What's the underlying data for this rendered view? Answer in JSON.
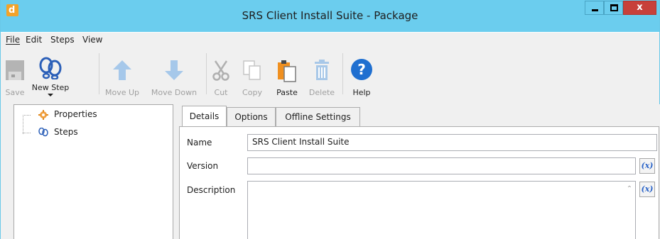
{
  "window": {
    "title": "SRS Client Install Suite - Package",
    "app_icon_letter": "d",
    "minimize_glyph": "_",
    "close_glyph": "x"
  },
  "menu": {
    "file": "File",
    "edit": "Edit",
    "steps": "Steps",
    "view": "View"
  },
  "toolbar": {
    "save": "Save",
    "new_step": "New Step",
    "move_up": "Move Up",
    "move_down": "Move Down",
    "cut": "Cut",
    "copy": "Copy",
    "paste": "Paste",
    "delete": "Delete",
    "help": "Help"
  },
  "tree": {
    "items": [
      {
        "label": "Properties",
        "icon": "properties-icon"
      },
      {
        "label": "Steps",
        "icon": "footprints-icon"
      }
    ]
  },
  "tabs": {
    "details": "Details",
    "options": "Options",
    "offline_settings": "Offline Settings"
  },
  "form": {
    "name_label": "Name",
    "name_value": "SRS Client Install Suite",
    "version_label": "Version",
    "version_value": "",
    "description_label": "Description",
    "description_value": "",
    "variable_button": "(x)"
  },
  "colors": {
    "titlebar": "#6bcdee",
    "close_button": "#c7403a",
    "accent_blue": "#2b64c8",
    "app_icon": "#f2a32a"
  }
}
